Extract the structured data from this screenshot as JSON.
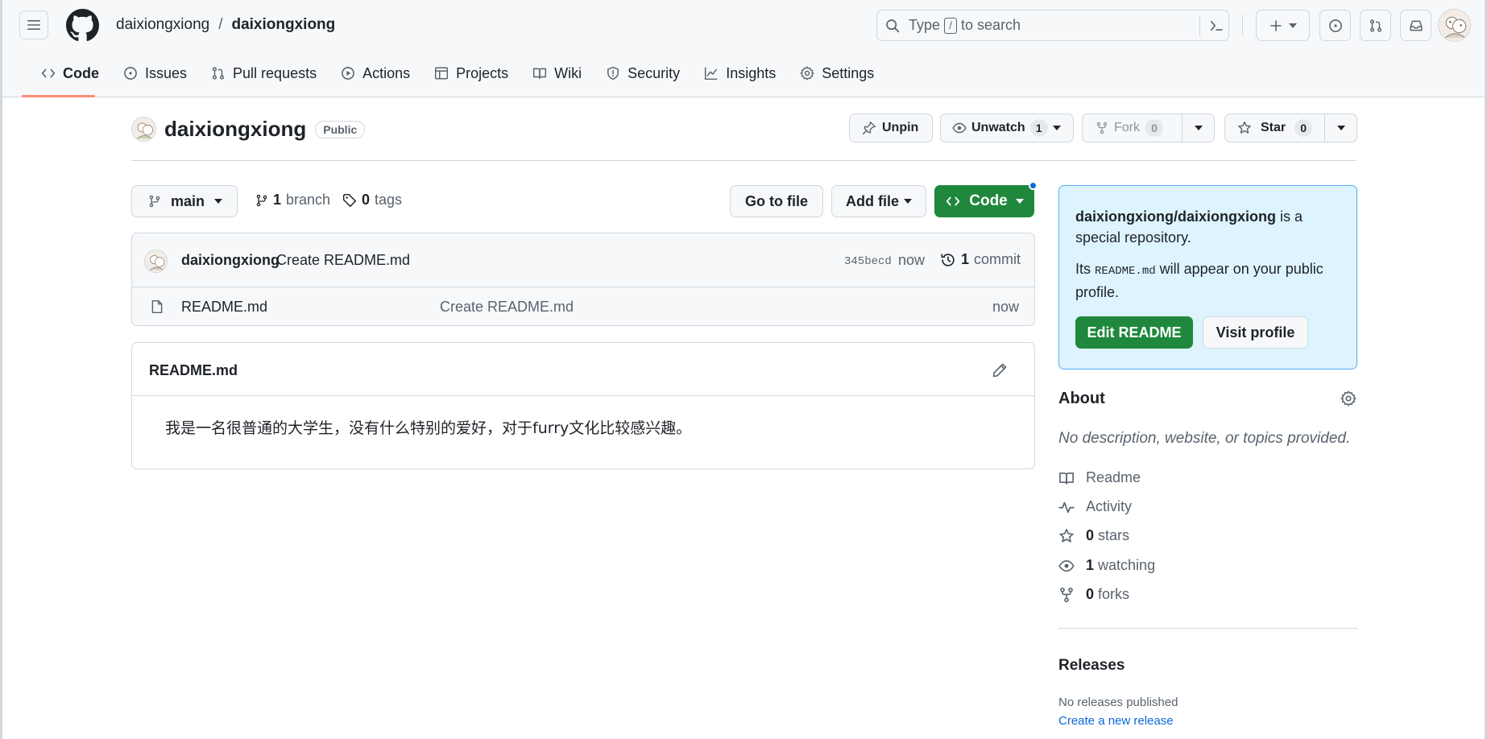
{
  "header": {
    "owner": "daixiongxiong",
    "separator": "/",
    "repo": "daixiongxiong",
    "search": {
      "prefix": "Type",
      "key": "/",
      "suffix": "to search"
    }
  },
  "nav": {
    "tabs": [
      {
        "label": "Code",
        "icon": "code-icon",
        "active": true
      },
      {
        "label": "Issues",
        "icon": "issue-opened-icon"
      },
      {
        "label": "Pull requests",
        "icon": "git-pull-request-icon"
      },
      {
        "label": "Actions",
        "icon": "play-icon"
      },
      {
        "label": "Projects",
        "icon": "table-icon"
      },
      {
        "label": "Wiki",
        "icon": "book-icon"
      },
      {
        "label": "Security",
        "icon": "shield-icon"
      },
      {
        "label": "Insights",
        "icon": "graph-icon"
      },
      {
        "label": "Settings",
        "icon": "gear-icon"
      }
    ]
  },
  "repo": {
    "name": "daixiongxiong",
    "visibility": "Public",
    "unpin_label": "Unpin",
    "unwatch_label": "Unwatch",
    "watch_count": "1",
    "fork_label": "Fork",
    "fork_count": "0",
    "star_label": "Star",
    "star_count": "0"
  },
  "toolbar": {
    "branch": "main",
    "branch_count": "1",
    "branch_label": "branch",
    "tag_count": "0",
    "tag_label": "tags",
    "go_to_file": "Go to file",
    "add_file": "Add file",
    "code": "Code"
  },
  "commit": {
    "author": "daixiongxiong",
    "message": "Create README.md",
    "sha": "345becd",
    "time": "now",
    "count": "1",
    "count_label": "commit"
  },
  "files": [
    {
      "name": "README.md",
      "message": "Create README.md",
      "time": "now"
    }
  ],
  "readme": {
    "title": "README.md",
    "body": "我是一名很普通的大学生，没有什么特别的爱好，对于furry文化比较感兴趣。"
  },
  "special": {
    "repo_path": "daixiongxiong/daixiongxiong",
    "line1_rest": " is a special repository.",
    "line2_prefix": "Its ",
    "line2_code": "README.md",
    "line2_rest": " will appear on your public profile.",
    "edit_label": "Edit README",
    "visit_label": "Visit profile"
  },
  "about": {
    "title": "About",
    "description": "No description, website, or topics provided.",
    "readme": "Readme",
    "activity": "Activity",
    "stars_count": "0",
    "stars_label": "stars",
    "watching_count": "1",
    "watching_label": "watching",
    "forks_count": "0",
    "forks_label": "forks"
  },
  "releases": {
    "title": "Releases",
    "none": "No releases published",
    "create": "Create a new release"
  },
  "colors": {
    "primary_green": "#1f883d",
    "link_blue": "#0969da",
    "active_underline": "#fd8c73",
    "special_bg": "#ddf4ff"
  }
}
